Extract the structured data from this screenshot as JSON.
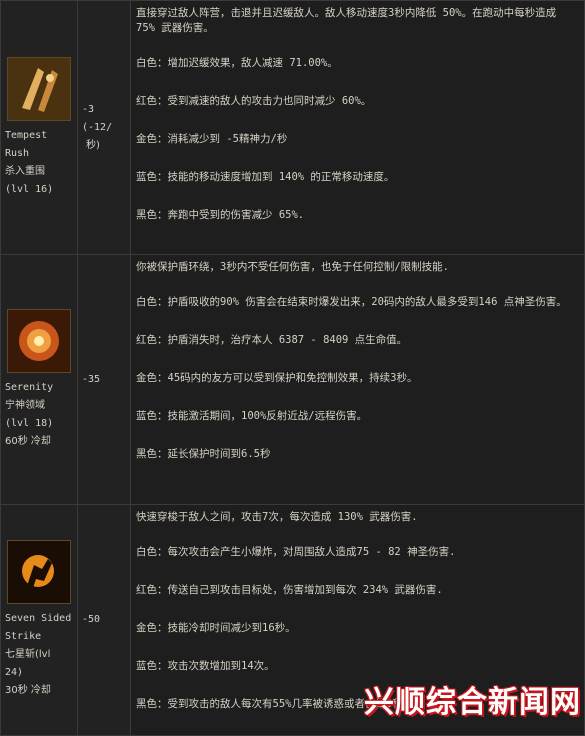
{
  "skills": [
    {
      "en": "Tempest\nRush",
      "cn": "杀入重围",
      "level": "(lvl 16)",
      "cooldown": "",
      "cost": [
        "-3",
        "(-12/",
        "秒)"
      ],
      "desc": [
        "直接穿过敌人阵营，击退并且迟缓敌人。敌人移动速度3秒内降低 50%。在跑动中每秒造成 75% 武器伤害。",
        "白色：增加迟缓效果，敌人减速 71.00%。",
        "红色：受到减速的敌人的攻击力也同时减少 60%。",
        "金色：消耗减少到 -5精神力/秒",
        "蓝色：技能的移动速度增加到 140% 的正常移动速度。",
        "黑色：奔跑中受到的伤害减少 65%."
      ]
    },
    {
      "en": "Serenity",
      "cn": "宁神领域",
      "level": "(lvl 18)",
      "cooldown": "60秒 冷却",
      "cost": [
        "-35"
      ],
      "desc": [
        "你被保护盾环绕，3秒内不受任何伤害，也免于任何控制/限制技能.",
        "白色：护盾吸收的90% 伤害会在结束时爆发出来，20码内的敌人最多受到146 点神圣伤害。",
        "红色：护盾消失时，治疗本人 6387 - 8409 点生命值。",
        "金色：45码内的友方可以受到保护和免控制效果，持续3秒。",
        "蓝色：技能激活期间，100%反射近战/远程伤害。",
        "黑色：延长保护时间到6.5秒"
      ]
    },
    {
      "en": "Seven Sided\nStrike",
      "cn": "七星斩(lvl",
      "level": "24)",
      "cooldown": "30秒 冷却",
      "cost": [
        "-50"
      ],
      "desc": [
        "快速穿梭于敌人之间，攻击7次，每次造成 130% 武器伤害.",
        "白色：每次攻击会产生小爆炸，对周围敌人造成75 - 82 神圣伤害.",
        "红色：传送自己到攻击目标处，伤害增加到每次 234% 武器伤害.",
        "金色：技能冷却时间减少到16秒。",
        "蓝色：攻击次数增加到14次。",
        "黑色：受到攻击的敌人每次有55%几率被诱惑或者击晕3秒。"
      ]
    }
  ],
  "watermark": "兴顺综合新闻网"
}
